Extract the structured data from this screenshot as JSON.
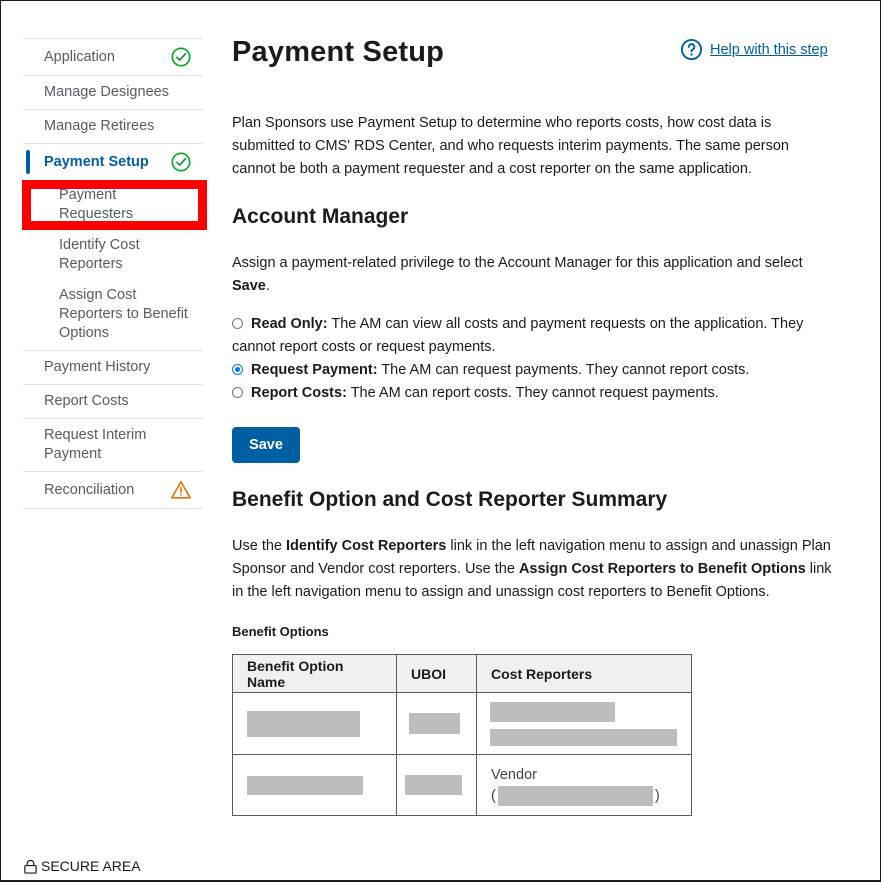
{
  "sidebar": {
    "items": [
      {
        "label": "Application",
        "status": "complete"
      },
      {
        "label": "Manage Designees"
      },
      {
        "label": "Manage Retirees"
      },
      {
        "label": "Payment Setup",
        "status": "complete",
        "current": true,
        "children": [
          {
            "label": "Payment Requesters",
            "highlighted": true
          },
          {
            "label": "Identify Cost Reporters"
          },
          {
            "label": "Assign Cost Reporters to Benefit Options"
          }
        ]
      },
      {
        "label": "Payment History"
      },
      {
        "label": "Report Costs"
      },
      {
        "label": "Request Interim Payment"
      },
      {
        "label": "Reconciliation",
        "status": "warning"
      }
    ]
  },
  "icons": {
    "complete": "check-circle-icon",
    "warning": "warning-icon",
    "help": "help-circle-icon",
    "secure": "lock-icon"
  },
  "colors": {
    "primary": "#005ea2",
    "success": "#00a91c",
    "warning": "#e66f0e",
    "highlight": "#ff0000"
  },
  "main": {
    "title": "Payment Setup",
    "help_link": "Help with this step",
    "intro": "Plan Sponsors use Payment Setup to determine who reports costs, how cost data is submitted to CMS' RDS Center, and who requests interim payments. The same person cannot be both a payment requester and a cost reporter on the same application.",
    "account_manager": {
      "heading": "Account Manager",
      "instruction": "Assign a payment-related privilege to the Account Manager for this application and select",
      "instruction_bold": "Save",
      "instruction_end": ".",
      "options": [
        {
          "label": "Read Only:",
          "desc": "The AM can view all costs and payment requests on the application. They cannot report costs or request payments.",
          "checked": false
        },
        {
          "label": "Request Payment:",
          "desc": "The AM can request payments. They cannot report costs.",
          "checked": true
        },
        {
          "label": "Report Costs:",
          "desc": "The AM can report costs. They cannot request payments.",
          "checked": false
        }
      ],
      "save_label": "Save"
    },
    "summary": {
      "heading": "Benefit Option and Cost Reporter Summary",
      "text_1": "Use the",
      "bold_1": "Identify Cost Reporters",
      "text_2": "link in the left navigation menu to assign and unassign Plan Sponsor and Vendor cost reporters. Use the",
      "bold_2": "Assign Cost Reporters to Benefit Options",
      "text_3": "link in the left navigation menu to assign and unassign cost reporters to Benefit Options.",
      "table_label": "Benefit Options",
      "columns": [
        "Benefit Option Name",
        "UBOI",
        "Cost Reporters"
      ],
      "rows": [
        {
          "name": "[redacted]",
          "uboi": "[redacted]",
          "reporters": [
            "[redacted]",
            "[redacted]"
          ]
        },
        {
          "name": "[redacted]",
          "uboi": "[redacted]",
          "reporters_type": "Vendor",
          "reporters_open": "(",
          "reporters_close": ")",
          "reporters": [
            "[redacted]"
          ]
        }
      ]
    }
  },
  "footer": {
    "secure_label": "SECURE AREA"
  }
}
